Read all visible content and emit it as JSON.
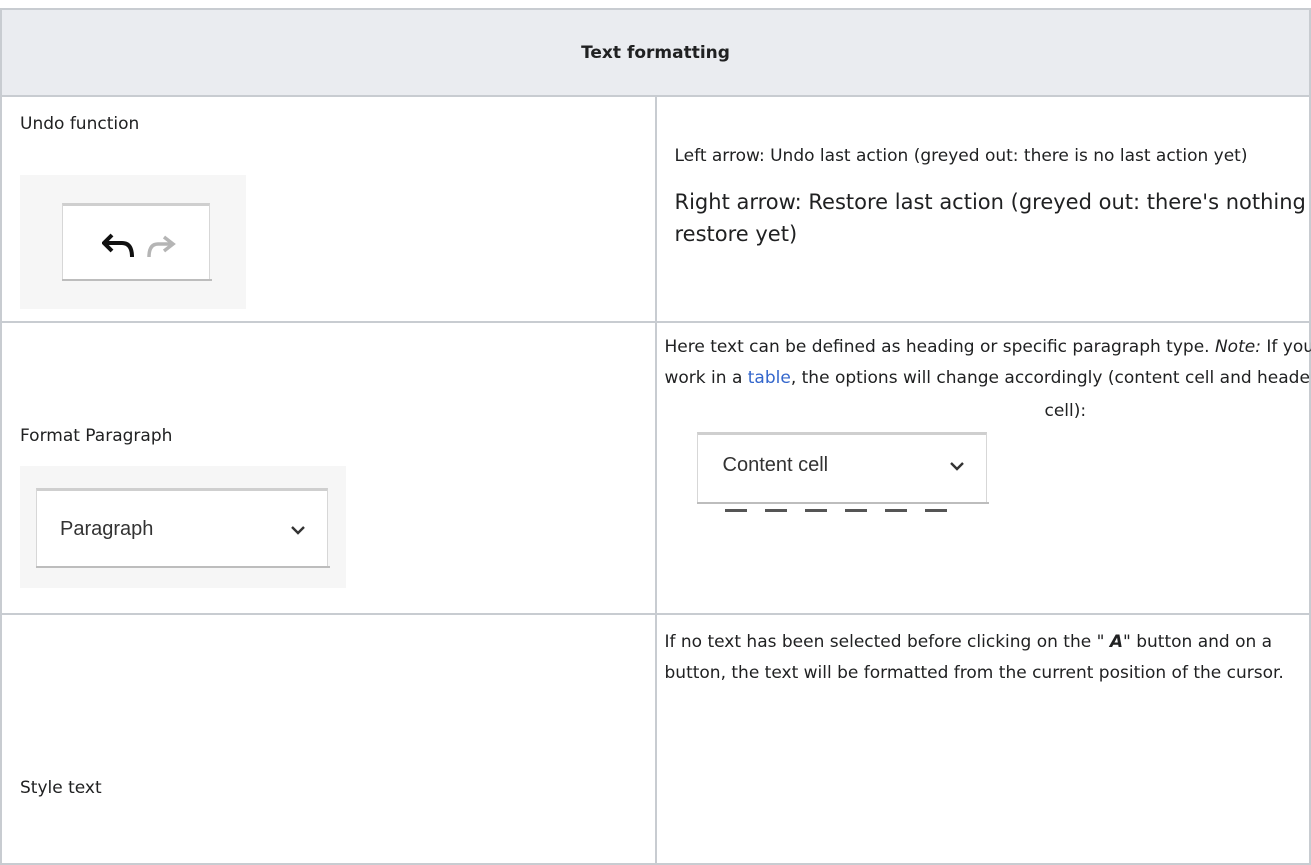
{
  "table": {
    "header": "Text formatting",
    "rows": [
      {
        "label": "Undo function",
        "desc_1": "Left arrow: Undo last action (greyed out: there is no last action yet)",
        "desc_2a": "Right arrow: Restore last action (greyed out: there's nothing to",
        "desc_2b": "restore yet)",
        "icons": [
          "undo-arrow-icon",
          "redo-arrow-icon"
        ]
      },
      {
        "label": "Format Paragraph",
        "desc_line1_before_note": "Here text can be defined as heading or specific paragraph type. ",
        "note_label": "Note:",
        "desc_line1_after_note": " If you",
        "desc_line2_before_link": "work in a ",
        "link_text": "table",
        "desc_line2_after_link": ", the options will change accordingly (content cell and header",
        "desc_line3": "cell):",
        "select_paragraph": "Paragraph",
        "select_content_cell": "Content cell"
      },
      {
        "label": "Style text",
        "desc_line1_before": "If no text has been selected before clicking on the \" ",
        "button_glyph": "A",
        "desc_line1_after": "\" button and on a",
        "desc_line2": "button, the text will be formatted from the current position of the cursor."
      }
    ]
  },
  "colors": {
    "link": "#3366cc",
    "header_bg": "#eaecf0",
    "border": "#c8ccd1"
  }
}
